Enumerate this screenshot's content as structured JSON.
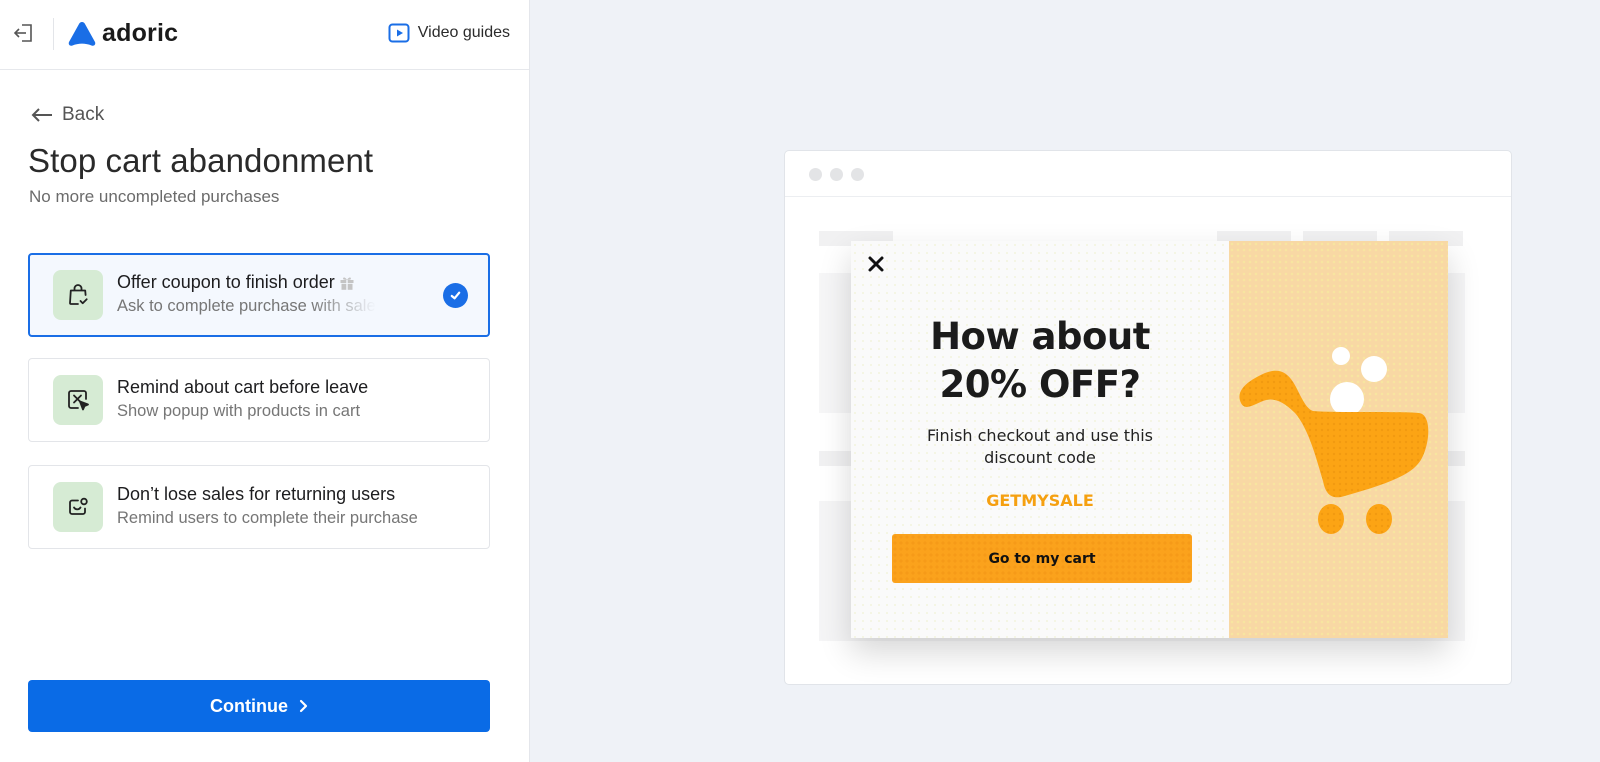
{
  "header": {
    "logo_text": "adoric",
    "video_guides_label": "Video guides",
    "icons": {
      "exit": "exit-icon",
      "video": "play-icon"
    }
  },
  "colors": {
    "accent": "#0a6be6",
    "selected_border": "#1a6ee6",
    "option_icon_bg": "#d6ebd4",
    "popup_accent": "#fba21c",
    "popup_code": "#f5a010",
    "preview_bg": "#eff2f7"
  },
  "nav": {
    "back_label": "Back"
  },
  "page": {
    "title": "Stop cart abandonment",
    "subtitle": "No more uncompleted purchases"
  },
  "options": [
    {
      "title": "Offer coupon to finish order",
      "description": "Ask to complete purchase with sale",
      "icon": "bag-check-icon",
      "badge_icon": "gift-icon",
      "selected": true
    },
    {
      "title": "Remind about cart before leave",
      "description": "Show popup with products in cart",
      "icon": "exit-intent-cursor-icon",
      "selected": false
    },
    {
      "title": "Don’t lose sales for returning users",
      "description": "Remind users to complete their purchase",
      "icon": "returning-user-icon",
      "selected": false
    }
  ],
  "continue_label": "Continue",
  "preview": {
    "popup": {
      "headline_line1": "How about",
      "headline_line2": "20% OFF?",
      "body_line1": "Finish checkout and use this",
      "body_line2": "discount code",
      "code": "GETMYSALE",
      "cta_label": "Go to my cart",
      "image": "shopping-cart-illustration"
    }
  }
}
